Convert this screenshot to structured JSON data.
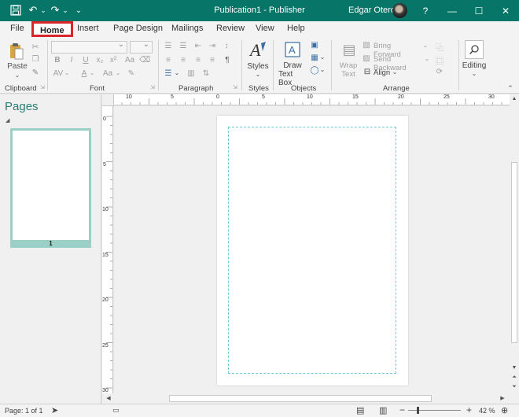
{
  "titlebar": {
    "title": "Publication1  -  Publisher",
    "user": "Edgar Otero",
    "help": "?",
    "minimize": "—",
    "restore": "☐",
    "close": "✕",
    "save_icon": "💾",
    "undo": "↶",
    "redo": "↷",
    "customize": "⌄"
  },
  "tabs": [
    "File",
    "Home",
    "Insert",
    "Page Design",
    "Mailings",
    "Review",
    "View",
    "Help"
  ],
  "active_tab": "Home",
  "ribbon": {
    "groups": {
      "clipboard": "Clipboard",
      "font": "Font",
      "paragraph": "Paragraph",
      "styles": "Styles",
      "objects": "Objects",
      "arrange": "Arrange"
    },
    "paste": "Paste",
    "styles_btn": "Styles",
    "draw_text_box_1": "Draw",
    "draw_text_box_2": "Text Box",
    "wrap_text_1": "Wrap",
    "wrap_text_2": "Text",
    "bring_forward": "Bring Forward",
    "send_backward": "Send Backward",
    "align": "Align",
    "editing": "Editing",
    "font_buttons": [
      "B",
      "I",
      "U",
      "x₂",
      "x²",
      "Aa"
    ],
    "font_color": "A",
    "char_spacing": "AV",
    "change_case": "Aa",
    "pilcrow": "¶"
  },
  "pages_pane": {
    "title": "Pages",
    "page_number": "1"
  },
  "ruler": {
    "h_labels": [
      "10",
      "5",
      "0",
      "5",
      "10",
      "15",
      "20",
      "25",
      "30"
    ],
    "v_labels": [
      "0",
      "5",
      "10",
      "15",
      "20",
      "25",
      "30"
    ]
  },
  "status": {
    "page": "Page: 1 of 1",
    "zoom": "42 %",
    "zoom_out": "−",
    "zoom_in": "+"
  }
}
